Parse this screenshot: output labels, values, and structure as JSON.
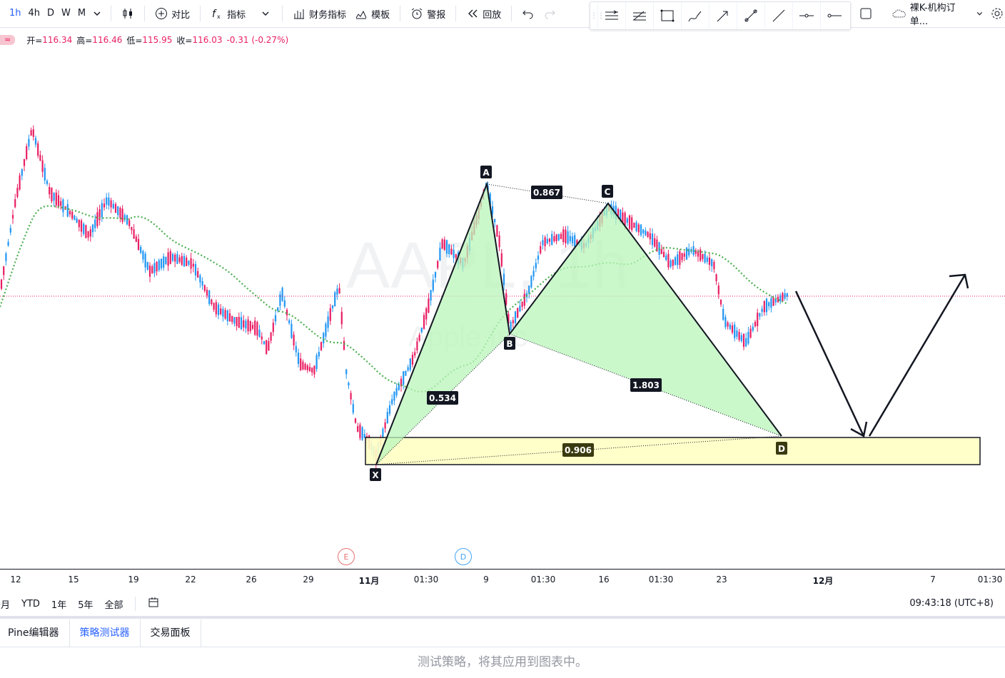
{
  "toolbar": {
    "timeframes": [
      "1h",
      "4h",
      "D",
      "W",
      "M"
    ],
    "compare": "对比",
    "indicators": "指标",
    "financials": "财务指标",
    "templates": "模板",
    "alert": "警报",
    "replay": "回放",
    "layout_name": "裸K-机构订单..."
  },
  "legend": {
    "open_label": "开=",
    "open": "116.34",
    "high_label": "高=",
    "high": "116.46",
    "low_label": "低=",
    "low": "115.95",
    "close_label": "收=",
    "close": "116.03",
    "change": "-0.31 (-0.27%)"
  },
  "watermark": {
    "symbol": "AAPL, 1h",
    "name": "Apple Inc"
  },
  "pattern": {
    "points": {
      "X": "X",
      "A": "A",
      "B": "B",
      "C": "C",
      "D": "D"
    },
    "ratios": {
      "xab": "0.534",
      "abc": "0.867",
      "bcd": "1.803",
      "xad": "0.906"
    }
  },
  "events": {
    "earnings": "E",
    "dividend": "D"
  },
  "time_axis": [
    "12",
    "15",
    "19",
    "22",
    "26",
    "29",
    "11月",
    "01:30",
    "9",
    "01:30",
    "16",
    "01:30",
    "23",
    "12月",
    "7",
    "01:30"
  ],
  "range_bar": [
    "个月",
    "YTD",
    "1年",
    "5年",
    "全部"
  ],
  "clock": "09:43:18 (UTC+8)",
  "bottom_tabs": [
    "Pine编辑器",
    "策略测试器",
    "交易面板"
  ],
  "hint": "测试策略，将其应用到图表中。",
  "colors": {
    "up": "#2196f3",
    "down": "#e91e63",
    "ma_orange": "#ff9800",
    "ma_green": "#4caf50",
    "pattern_fill": "#b9f6b9",
    "zone_fill": "#ffffc4",
    "accent": "#2962ff"
  }
}
